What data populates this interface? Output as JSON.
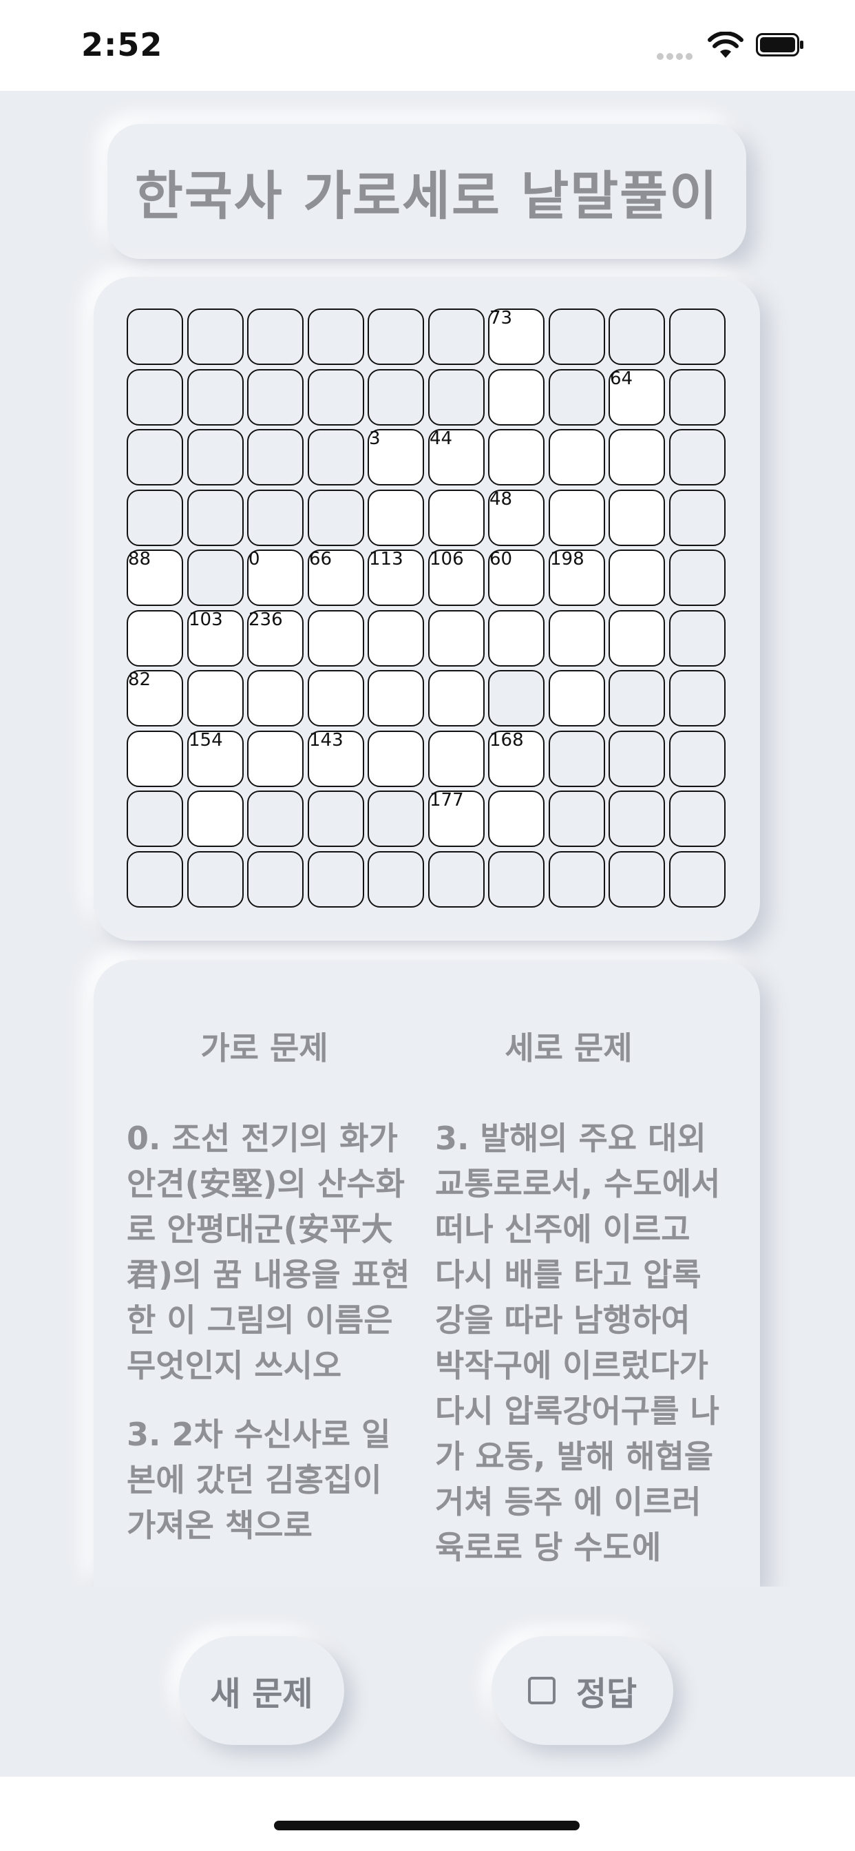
{
  "status_bar": {
    "time": "2:52"
  },
  "title": "한국사 가로세로 낱말풀이",
  "grid": {
    "rows": [
      "0000001000",
      "0000001010",
      "0000111110",
      "0000111110",
      "1011111110",
      "1111111110",
      "1111110100",
      "1111111000",
      "0100011000",
      "0000000000"
    ],
    "numbers": [
      {
        "row": 0,
        "col": 6,
        "label": "73"
      },
      {
        "row": 1,
        "col": 8,
        "label": "64"
      },
      {
        "row": 2,
        "col": 4,
        "label": "3"
      },
      {
        "row": 2,
        "col": 5,
        "label": "44"
      },
      {
        "row": 3,
        "col": 6,
        "label": "48"
      },
      {
        "row": 4,
        "col": 0,
        "label": "88"
      },
      {
        "row": 4,
        "col": 2,
        "label": "0"
      },
      {
        "row": 4,
        "col": 3,
        "label": "66"
      },
      {
        "row": 4,
        "col": 4,
        "label": "113"
      },
      {
        "row": 4,
        "col": 5,
        "label": "106"
      },
      {
        "row": 4,
        "col": 6,
        "label": "60"
      },
      {
        "row": 4,
        "col": 7,
        "label": "198"
      },
      {
        "row": 5,
        "col": 1,
        "label": "103"
      },
      {
        "row": 5,
        "col": 2,
        "label": "236"
      },
      {
        "row": 6,
        "col": 0,
        "label": "82"
      },
      {
        "row": 7,
        "col": 1,
        "label": "154"
      },
      {
        "row": 7,
        "col": 3,
        "label": "143"
      },
      {
        "row": 7,
        "col": 6,
        "label": "168"
      },
      {
        "row": 8,
        "col": 5,
        "label": "177"
      }
    ]
  },
  "clues": {
    "across_header": "가로 문제",
    "down_header": "세로 문제",
    "across": [
      "0.  조선 전기의 화가 안견(安堅)의 산수화로 안평대군(安平大君)의 꿈 내용을 표현한 이 그림의 이름은 무엇인지 쓰시오",
      "3.  2차 수신사로 일본에 갔던 김홍집이 가져온 책으로"
    ],
    "down": [
      "3.  발해의 주요 대외 교통로로서, 수도에서 떠나 신주에 이르고 다시 배를 타고 압록강을 따라 남행하여 박작구에 이르렀다가 다시 압록강어구를 나가 요동, 발해 해협을 거쳐 등주 에 이르러 육로로 당 수도에"
    ]
  },
  "buttons": {
    "new_problem": "새 문제",
    "answer": "정답"
  }
}
